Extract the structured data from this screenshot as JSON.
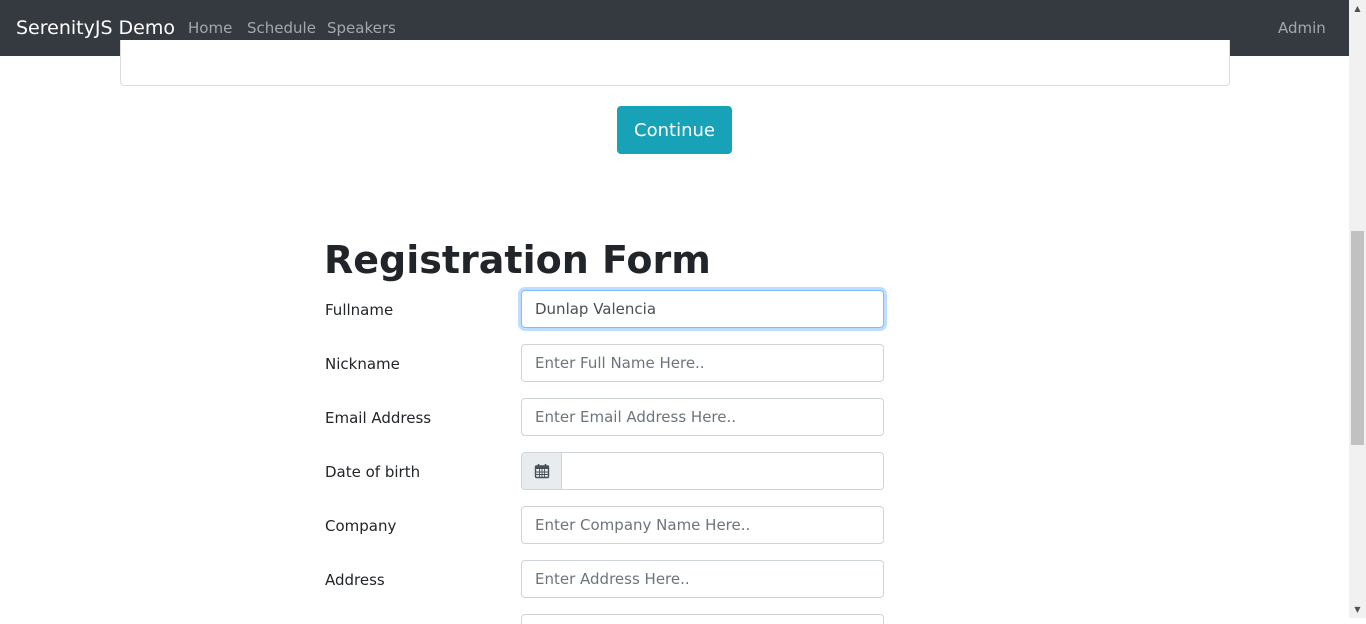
{
  "navbar": {
    "brand": "SerenityJS Demo",
    "links": [
      "Home",
      "Schedule",
      "Speakers"
    ],
    "admin": "Admin"
  },
  "continue_button": "Continue",
  "form": {
    "title": "Registration Form",
    "fields": {
      "fullname": {
        "label": "Fullname",
        "value": "Dunlap Valencia",
        "placeholder": ""
      },
      "nickname": {
        "label": "Nickname",
        "value": "",
        "placeholder": "Enter Full Name Here.."
      },
      "email": {
        "label": "Email Address",
        "value": "",
        "placeholder": "Enter Email Address Here.."
      },
      "dob": {
        "label": "Date of birth",
        "value": "",
        "icon": "calendar-icon"
      },
      "company": {
        "label": "Company",
        "value": "",
        "placeholder": "Enter Company Name Here.."
      },
      "address": {
        "label": "Address",
        "value": "",
        "placeholder": "Enter Address Here.."
      }
    }
  },
  "colors": {
    "navbar_bg": "#343a40",
    "accent": "#17a2b8",
    "focus_border": "#80bdff"
  }
}
